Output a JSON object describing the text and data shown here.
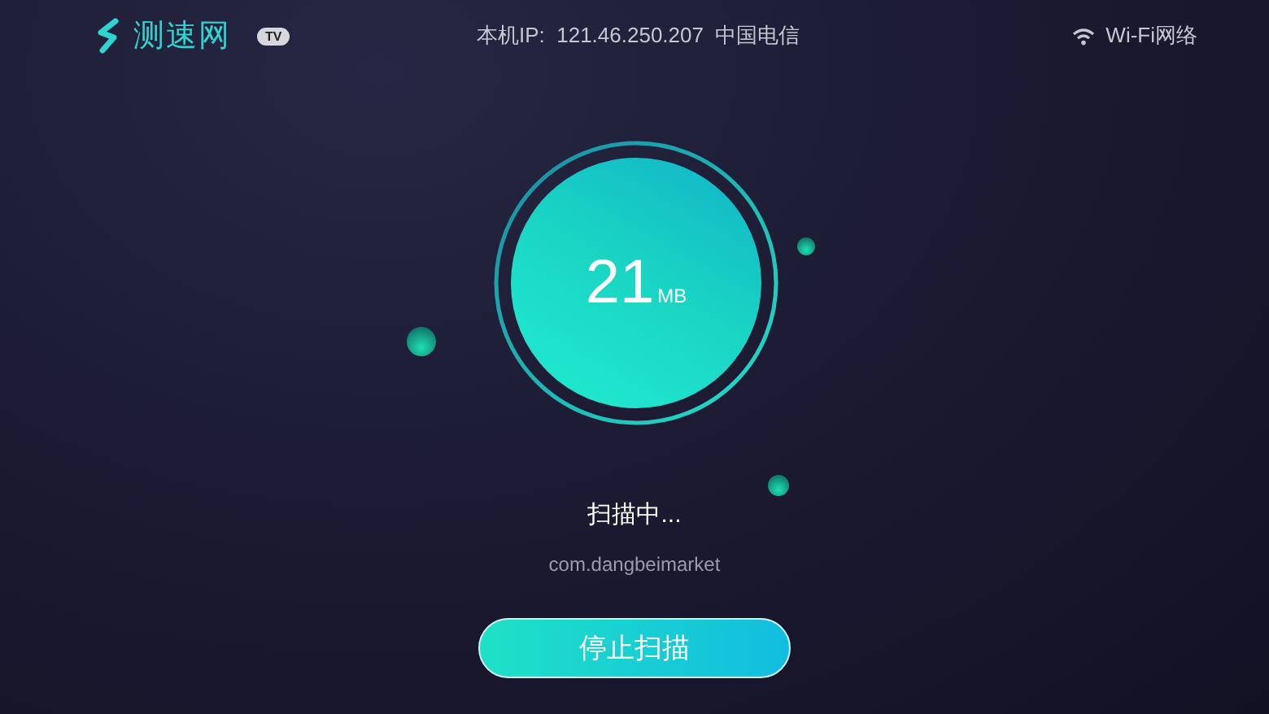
{
  "header": {
    "brand": "测速网",
    "badge": "TV",
    "ip_info": "本机IP:  121.46.250.207  中国电信",
    "network": "Wi-Fi网络"
  },
  "gauge": {
    "value": "21",
    "unit": "MB"
  },
  "status": "扫描中...",
  "package": "com.dangbeimarket",
  "button": "停止扫描"
}
